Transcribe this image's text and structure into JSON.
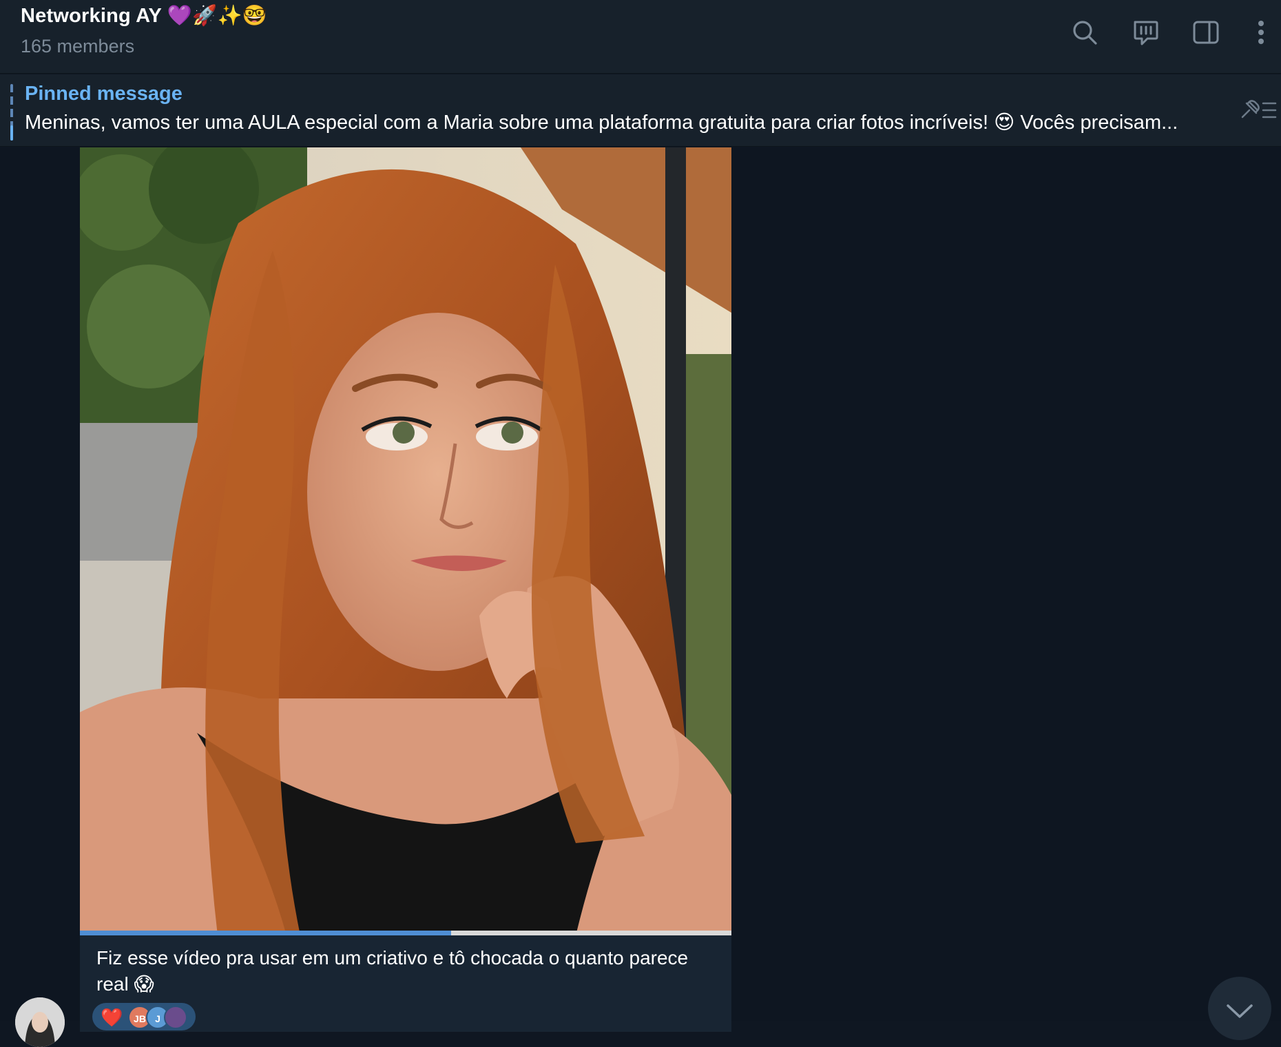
{
  "header": {
    "title": "Networking AY 💜🚀✨🤓",
    "subtitle": "165 members",
    "icons": [
      "search-icon",
      "video-chat-icon",
      "sidebar-toggle-icon",
      "more-options-icon"
    ]
  },
  "pinned": {
    "label": "Pinned message",
    "text": "Meninas, vamos ter uma AULA especial com a Maria  sobre uma plataforma gratuita para criar fotos incríveis! 😍  Vocês precisam...",
    "icon": "pinned-list-icon"
  },
  "message": {
    "media_type": "video",
    "playback_progress": 0.57,
    "caption": "Fiz esse vídeo pra usar em um criativo e tô chocada o quanto parece real 😱",
    "reactions": {
      "emoji": "❤️",
      "avatars": [
        "JB",
        "J"
      ]
    }
  },
  "colors": {
    "header_bg": "#17212b",
    "chat_bg": "#0e1621",
    "accent": "#6ab3f3",
    "bubble_bg": "#182533",
    "progress": "#4f8ed4"
  }
}
